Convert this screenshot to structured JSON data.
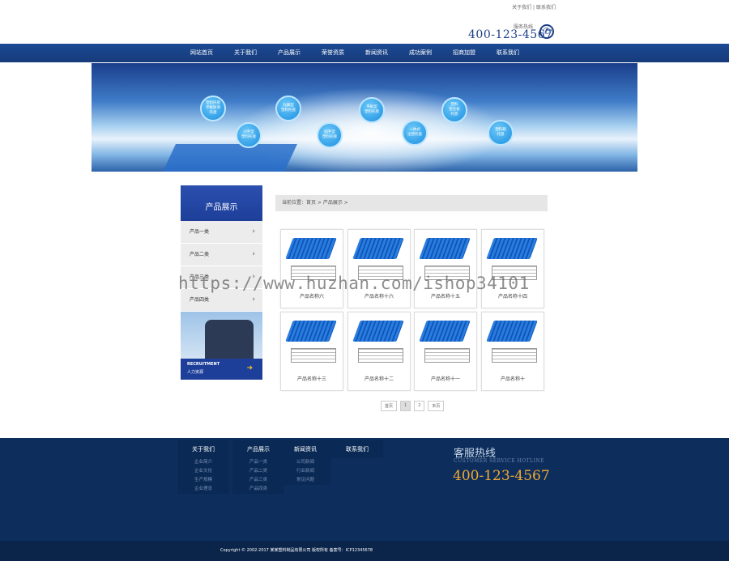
{
  "header": {
    "top_links": [
      "关于我们",
      "联系我们"
    ],
    "top_links_sep": " | ",
    "hotline_label": "服务热线",
    "hotline_number": "400-123-4567",
    "accent": "#1b3f86"
  },
  "nav": {
    "items": [
      "网站首页",
      "关于我们",
      "产品展示",
      "荣誉资质",
      "新闻资讯",
      "成功案例",
      "招商加盟",
      "联系我们"
    ]
  },
  "banner": {
    "bubbles": [
      "塑料托盘\n平板防滑\n托盘",
      "川字型\n塑料托盘",
      "九脚型\n塑料托盘",
      "田字型\n塑料托盘",
      "平板型\n塑料托盘",
      "一体式\n注塑托盘",
      "塑料\n垫仓板\n托盘",
      "塑料箱\n托盘"
    ]
  },
  "sidebar": {
    "title": "产品展示",
    "items": [
      "产品一类",
      "产品二类",
      "产品三类",
      "产品四类"
    ],
    "recruit_en": "RECRUITMENT",
    "recruit_cn": "人力资源"
  },
  "breadcrumb": "当前位置：首页 > 产品展示 >",
  "products": [
    "产品名称六",
    "产品名称十六",
    "产品名称十五",
    "产品名称十四",
    "产品名称十三",
    "产品名称十二",
    "产品名称十一",
    "产品名称十"
  ],
  "pager": [
    "首页",
    "1",
    "2",
    "末页"
  ],
  "watermark": "https://www.huzhan.com/ishop34101",
  "footer": {
    "cols": [
      {
        "title": "关于我们",
        "links": [
          "企业简介",
          "企业文化",
          "生产规模",
          "企业理念"
        ]
      },
      {
        "title": "产品展示",
        "links": [
          "产品一类",
          "产品二类",
          "产品三类",
          "产品四类"
        ]
      },
      {
        "title": "新闻资讯",
        "links": [
          "公司新闻",
          "行业新闻",
          "常见问题"
        ]
      },
      {
        "title": "联系我们",
        "links": []
      }
    ],
    "hotline_title": "客服热线",
    "hotline_en": "CUSTOMER SERVICE HOTLINE",
    "hotline_number": "400-123-4567",
    "copyright": "Copyright © 2002-2017 某某塑料制品有限公司 版权所有 备案号：ICP12345678"
  }
}
